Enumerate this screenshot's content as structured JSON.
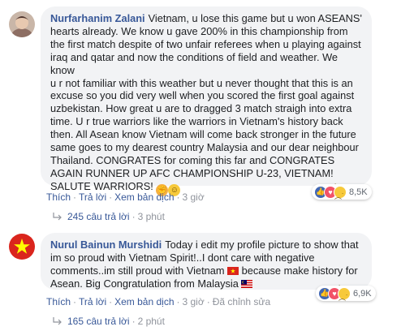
{
  "comments": [
    {
      "author": "Nurfarhanim Zalani",
      "text": "Vietnam, u lose this game but u won ASEANS'\nhearts already. We know u gave 200% in this championship from\nthe first match despite of two unfair referees when u playing against\niraq and qatar and now the conditions of field and weather. We know\nu r not familiar with this weather but u never thought that this is an\nexcuse so you did very well when you scored the first goal against\nuzbekistan. How great u are to dragged 3 match straigh into extra\ntime. U r true warriors like the warriors in Vietnam's history back\nthen. All Asean know Vietnam will come back stronger in the future\nsame goes to my dearest country Malaysia and our dear neighbour\nThailand. CONGRATES for coming this far and CONGRATES\nAGAIN RUNNER UP AFC CHAMPIONSHIP U-23, VIETNAM!\nSALUTE WARRIORS!",
      "emojis": [
        "muscle-emoji",
        "smile-emoji"
      ],
      "actions": {
        "like": "Thích",
        "reply": "Trả lời",
        "translate": "Xem bản dịch",
        "time": "3 giờ"
      },
      "reactions": {
        "icons": [
          "like",
          "love",
          "sad"
        ],
        "count": "8,5K"
      },
      "replies": {
        "label": "245 câu trả lời",
        "time": "3 phút"
      }
    },
    {
      "author": "Nurul Bainun Murshidi",
      "text_1": "Today i edit my profile picture to show that\nim so proud with Vietnam Spirit!..I dont care with negative\ncomments..im still proud with Vietnam",
      "text_2": "because make history for\nAsean. Big Congratulation from Malaysia",
      "actions": {
        "like": "Thích",
        "reply": "Trả lời",
        "translate": "Xem bản dịch",
        "time": "3 giờ",
        "edited": "Đã chỉnh sửa"
      },
      "reactions": {
        "icons": [
          "like",
          "love",
          "sad"
        ],
        "count": "6,9K"
      },
      "replies": {
        "label": "165 câu trả lời",
        "time": "2 phút"
      }
    }
  ],
  "colors": {
    "link": "#385898",
    "bubble": "#f2f3f5",
    "meta": "#90949c",
    "vietnam_red": "#da251d",
    "vietnam_star": "#ffff00"
  }
}
